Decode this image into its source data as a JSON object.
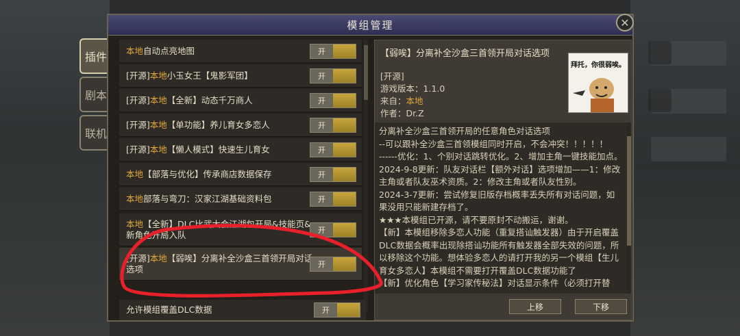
{
  "dialog": {
    "title": "模组管理"
  },
  "side_tabs": [
    {
      "label": "插件"
    },
    {
      "label": "剧本"
    },
    {
      "label": "联机"
    }
  ],
  "mods": [
    {
      "prefix": "",
      "source": "本地",
      "name": "自动点亮地图",
      "toggle": "开"
    },
    {
      "prefix": "[开源]",
      "source": "本地",
      "name": "小玉女王【鬼影军团】",
      "toggle": "开"
    },
    {
      "prefix": "[开源]",
      "source": "本地",
      "name": "【全新】动态千万商人",
      "toggle": "开"
    },
    {
      "prefix": "[开源]",
      "source": "本地",
      "name": "【单功能】养儿育女多恋人",
      "toggle": "开"
    },
    {
      "prefix": "[开源]",
      "source": "本地",
      "name": "【懒人模式】快速生儿育女",
      "toggle": "开"
    },
    {
      "prefix": "",
      "source": "本地",
      "name": "【部落与优化】传承商店数据保存",
      "toggle": "开"
    },
    {
      "prefix": "",
      "source": "本地",
      "name": "部落与弯刀：汉家江湖基础资料包",
      "toggle": "开"
    },
    {
      "prefix": "",
      "source": "本地",
      "name": "【全新】DLC比武大会江湖包开局&技能页&新角色开局入队",
      "toggle": "开"
    },
    {
      "prefix": "[开源]",
      "source": "本地",
      "name": "【弱唉】分离补全沙盒三首领开局对话选项",
      "toggle": "开"
    }
  ],
  "footer": {
    "label": "允许模组覆盖DLC数据",
    "toggle": "开"
  },
  "detail": {
    "title": "【弱唉】分离补全沙盒三首领开局对话选项",
    "tag": "[开源]",
    "version_label": "游戏版本：",
    "version": "1.1.0",
    "from_label": "来自：",
    "from": "本地",
    "author_label": "作者：",
    "author": "Dr.Z",
    "thumb_caption": "拜托，你很弱唉。",
    "description": [
      "分离补全沙盒三首领开局的任意角色对话选项",
      "--可以跟补全沙盒三首领模组同时开启，不会冲突！！！！！",
      "------优化：1、个别对话跳转优化。2、增加主角一键技能加点。",
      "2024-9-8更新：队友对话栏【额外对话】选项增加——1：修改主角或者队友巫术资质。2：修改主角或者队友性别。",
      "2024-3-7更新：尝试修复旧版存档概率丢失所有对话问题，如果没用只能新建存档了。",
      "★★★本模组已开源，请不要原封不动搬运，谢谢。",
      "【新】本模组移除多恋人功能（重复搭讪触发器）由于开启覆盖DLC数据会概率出现除搭讪功能所有触发器全部失效的问题，所以移除这个功能。想体验多恋人的请打开我的另一个模组【生儿育女多恋人】本模组不需要打开覆盖DLC数据功能了",
      "【新】优化角色【学习家传秘法】对话显示条件（必须打开替"
    ],
    "up_label": "上移",
    "down_label": "下移"
  },
  "colors": {
    "source_accent": "#e0a73a",
    "toggle_knob": "#c7a53b",
    "annotation": "#e8202a"
  }
}
